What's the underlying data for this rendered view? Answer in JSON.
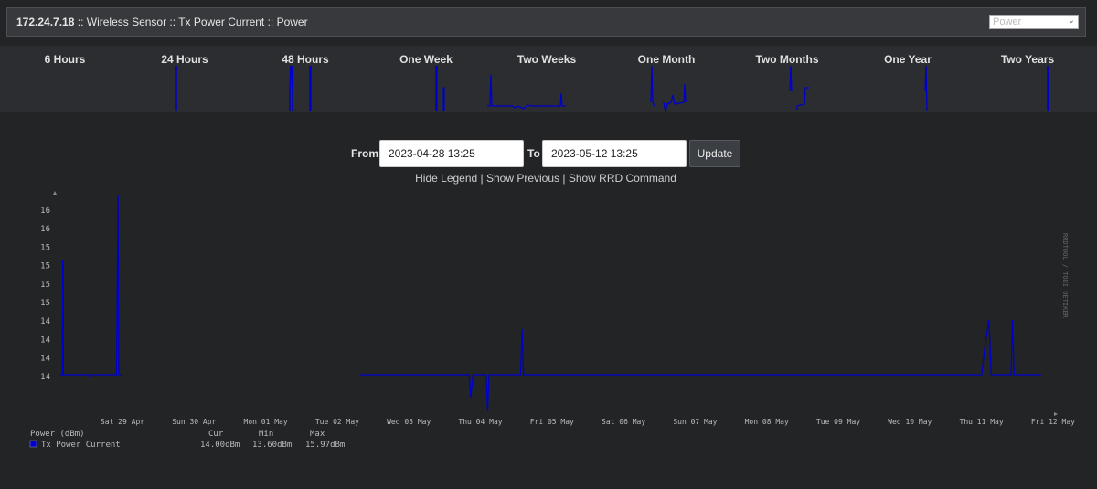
{
  "header": {
    "host": "172.24.7.18",
    "crumbs": " :: Wireless Sensor :: Tx Power Current :: Power",
    "select_value": "Power"
  },
  "timespans": [
    "6 Hours",
    "24 Hours",
    "48 Hours",
    "One Week",
    "Two Weeks",
    "One Month",
    "Two Months",
    "One Year",
    "Two Years"
  ],
  "range": {
    "from_label": "From",
    "from_value": "2023-04-28 13:25",
    "to_label": "To",
    "to_value": "2023-05-12 13:25",
    "update_label": "Update"
  },
  "links": {
    "hide_legend": "Hide Legend",
    "sep": " | ",
    "show_previous": "Show Previous",
    "show_rrd": "Show RRD Command"
  },
  "chart_data": {
    "type": "line",
    "series": [
      {
        "name": "Tx Power Current",
        "color": "#0000cc"
      }
    ],
    "y_ticks": [
      "16",
      "16",
      "15",
      "15",
      "15",
      "15",
      "14",
      "14",
      "14",
      "14"
    ],
    "x_ticks": [
      "Sat 29 Apr",
      "Sun 30 Apr",
      "Mon 01 May",
      "Tue 02 May",
      "Wed 03 May",
      "Thu 04 May",
      "Fri 05 May",
      "Sat 06 May",
      "Sun 07 May",
      "Mon 08 May",
      "Tue 09 May",
      "Wed 10 May",
      "Thu 11 May",
      "Fri 12 May"
    ],
    "ylim": [
      13.5,
      16.0
    ],
    "side_label": "RRDTOOL / TOBI OETIKER",
    "legend": {
      "unit_label": "Power (dBm)",
      "cols": [
        "Cur",
        "Min",
        "Max"
      ],
      "cur": "14.00dBm",
      "min": "13.60dBm",
      "max": "15.97dBm"
    },
    "points": [
      [
        0.0,
        14.0
      ],
      [
        0.04,
        14.0
      ],
      [
        0.045,
        15.25
      ],
      [
        0.05,
        15.25
      ],
      [
        0.055,
        14.0
      ],
      [
        0.4,
        14.0
      ],
      [
        0.43,
        13.98
      ],
      [
        0.45,
        14.0
      ],
      [
        0.7,
        14.0
      ],
      [
        0.78,
        14.0
      ],
      [
        0.8,
        15.97
      ],
      [
        0.81,
        14.0
      ],
      [
        0.85,
        14.0
      ],
      null,
      [
        4.1,
        14.0
      ],
      [
        5.6,
        14.0
      ],
      [
        5.62,
        13.75
      ],
      [
        5.65,
        14.0
      ],
      [
        5.83,
        14.0
      ],
      [
        5.85,
        13.6
      ],
      [
        5.87,
        14.0
      ],
      [
        6.3,
        14.0
      ],
      [
        6.32,
        14.5
      ],
      [
        6.34,
        14.0
      ],
      [
        12.6,
        14.0
      ],
      [
        12.65,
        14.35
      ],
      [
        12.7,
        14.6
      ],
      [
        12.73,
        14.0
      ],
      [
        13.0,
        14.0
      ],
      [
        13.02,
        14.6
      ],
      [
        13.04,
        14.0
      ],
      [
        13.41,
        14.0
      ]
    ]
  }
}
